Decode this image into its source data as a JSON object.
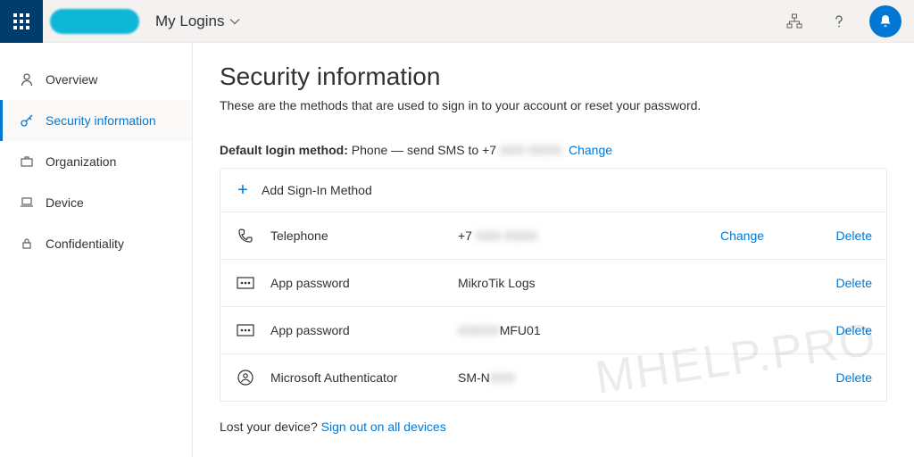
{
  "header": {
    "app_title": "My Logins"
  },
  "sidebar": {
    "items": [
      {
        "label": "Overview"
      },
      {
        "label": "Security information"
      },
      {
        "label": "Organization"
      },
      {
        "label": "Device"
      },
      {
        "label": "Confidentiality"
      }
    ]
  },
  "page": {
    "title": "Security information",
    "subtitle": "These are the methods that are used to sign in to your account or reset your password.",
    "default_label": "Default login method:",
    "default_text_prefix": "Phone — send SMS to +7 ",
    "default_redacted": "XXX XXXX",
    "change": "Change",
    "add_method": "Add Sign-In Method",
    "lost_prompt": "Lost your device? ",
    "lost_link": "Sign out on all devices"
  },
  "methods": [
    {
      "name": "Telephone",
      "value_prefix": "+7 ",
      "value_redacted": "XXX XXXX",
      "value_suffix": "",
      "change": "Change",
      "delete": "Delete",
      "icon": "phone"
    },
    {
      "name": "App password",
      "value_prefix": "",
      "value_redacted": "",
      "value_suffix": "MikroTik Logs",
      "change": "",
      "delete": "Delete",
      "icon": "dots"
    },
    {
      "name": "App password",
      "value_prefix": "",
      "value_redacted": "XXXXX",
      "value_suffix": "MFU01",
      "change": "",
      "delete": "Delete",
      "icon": "dots"
    },
    {
      "name": "Microsoft Authenticator",
      "value_prefix": "SM-N",
      "value_redacted": "XXX",
      "value_suffix": "",
      "change": "",
      "delete": "Delete",
      "icon": "auth"
    }
  ],
  "watermark": "MHELP.PRO"
}
